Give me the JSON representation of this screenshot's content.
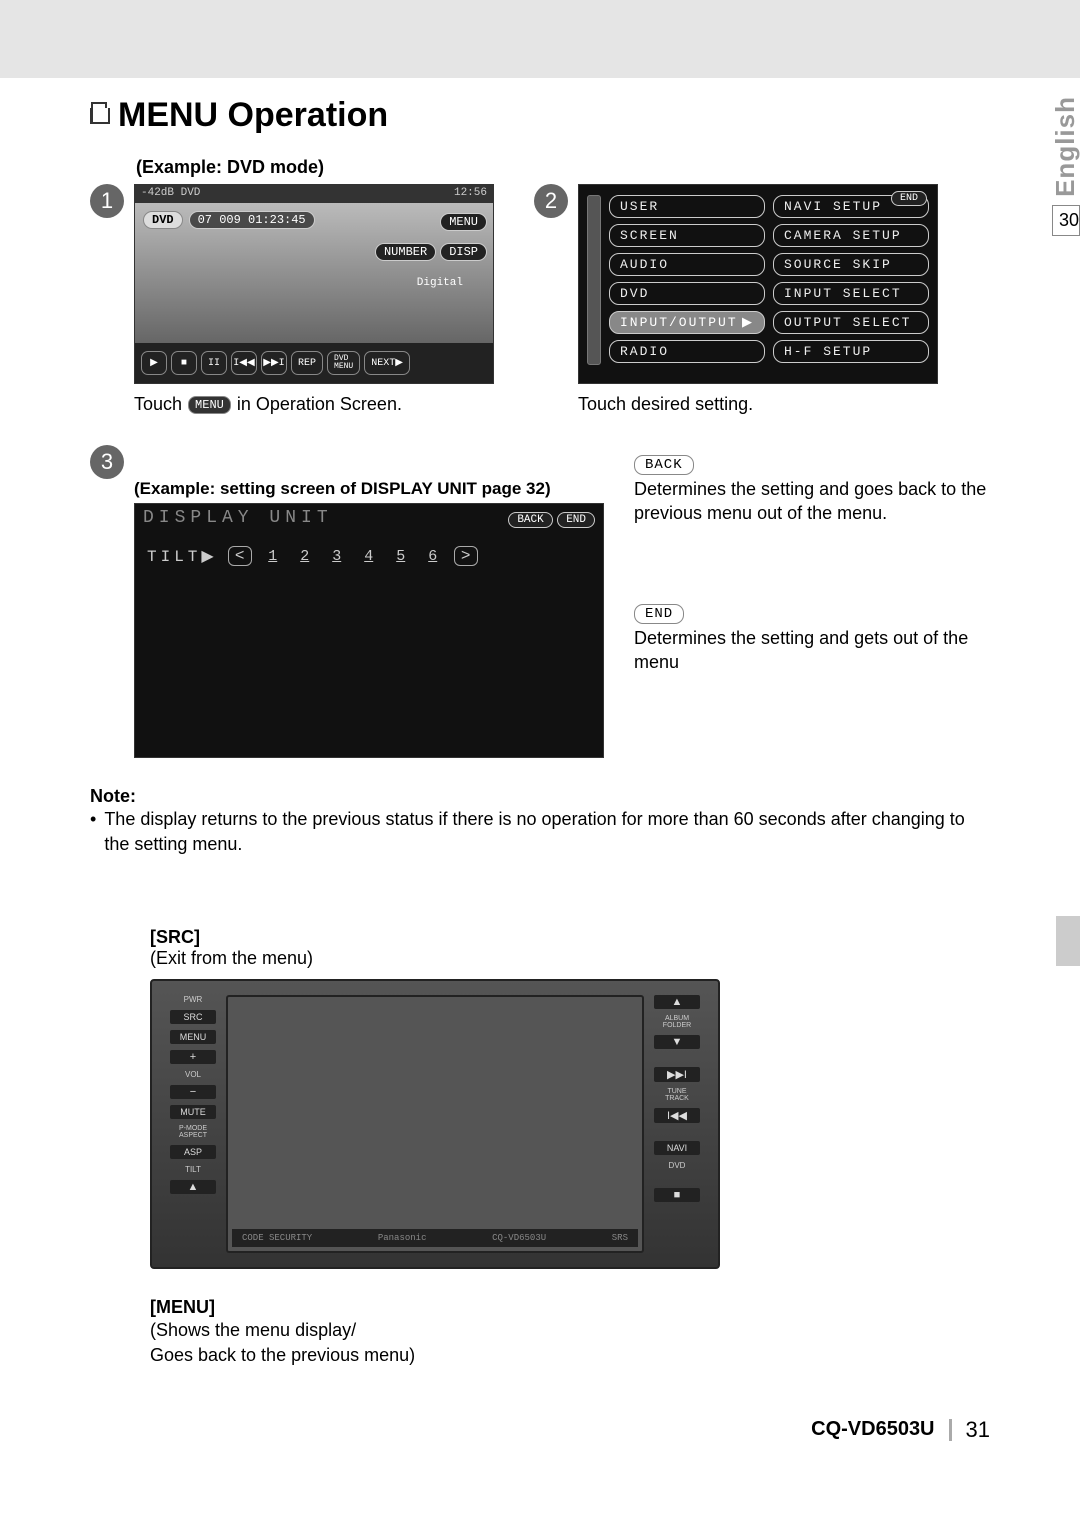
{
  "header": {
    "title": "MENU Operation"
  },
  "side": {
    "lang": "English",
    "prev_page": "30"
  },
  "step1": {
    "example": "(Example: DVD mode)",
    "num": "1",
    "topbar_left": "-42dB DVD",
    "topbar_right": "12:56",
    "dvd": "DVD",
    "track_info": "07  009 01:23:45",
    "menu": "MENU",
    "number": "NUMBER",
    "disp": "DISP",
    "digital": "Digital",
    "transport": {
      "play": "▶",
      "stop": "■",
      "pause": "II",
      "prev": "I◀◀",
      "next": "▶▶I",
      "rep": "REP",
      "dvdmenu": "DVD\nMENU",
      "nxt": "NEXT▶"
    },
    "caption_pre": "Touch",
    "caption_chip": "MENU",
    "caption_post": "in Operation Screen."
  },
  "step2": {
    "num": "2",
    "end": "END",
    "left": [
      "USER",
      "SCREEN",
      "AUDIO",
      "DVD",
      "INPUT/OUTPUT",
      "RADIO"
    ],
    "right": [
      "NAVI SETUP",
      "CAMERA SETUP",
      "SOURCE SKIP",
      "INPUT SELECT",
      "OUTPUT SELECT",
      "H-F SETUP"
    ],
    "sel_arrow": "▶",
    "caption": "Touch desired setting."
  },
  "step3": {
    "num": "3",
    "example": "(Example: setting screen of DISPLAY UNIT      page 32)",
    "title": "DISPLAY UNIT",
    "back": "BACK",
    "end": "END",
    "tilt": "TILT▶",
    "left": "<",
    "right": ">",
    "nums": [
      "1",
      "2",
      "3",
      "4",
      "5",
      "6"
    ],
    "back_desc": "Determines the setting and goes back to the previous menu out of the menu.",
    "end_desc": "Determines the setting and gets out of the menu"
  },
  "note": {
    "label": "Note:",
    "body": "The display returns to the previous status if there is no operation for more than 60 seconds after changing to the setting menu."
  },
  "device": {
    "src_h": "[SRC]",
    "src_d": "(Exit from the menu)",
    "left": {
      "pwr": "PWR",
      "src": "SRC",
      "menu": "MENU",
      "plus": "+",
      "vol": "VOL",
      "minus": "−",
      "mute": "MUTE",
      "pmode": "P-MODE\nASPECT",
      "asp": "ASP",
      "tilt": "TILT",
      "eject": "▲"
    },
    "right": {
      "up": "▲",
      "album": "ALBUM\nFOLDER",
      "down": "▼",
      "fwd": "▶▶I",
      "tune": "TUNE\nTRACK",
      "rev": "I◀◀",
      "navi": "NAVI",
      "dvd": "DVD",
      "open": "■"
    },
    "strip": {
      "sec": "CODE SECURITY",
      "brand": "Panasonic",
      "model": "CQ-VD6503U",
      "srs": "SRS"
    },
    "menu_h": "[MENU]",
    "menu_d1": "(Shows the menu display/",
    "menu_d2": " Goes back to the previous menu)"
  },
  "footer": {
    "model": "CQ-VD6503U",
    "page": "31"
  }
}
